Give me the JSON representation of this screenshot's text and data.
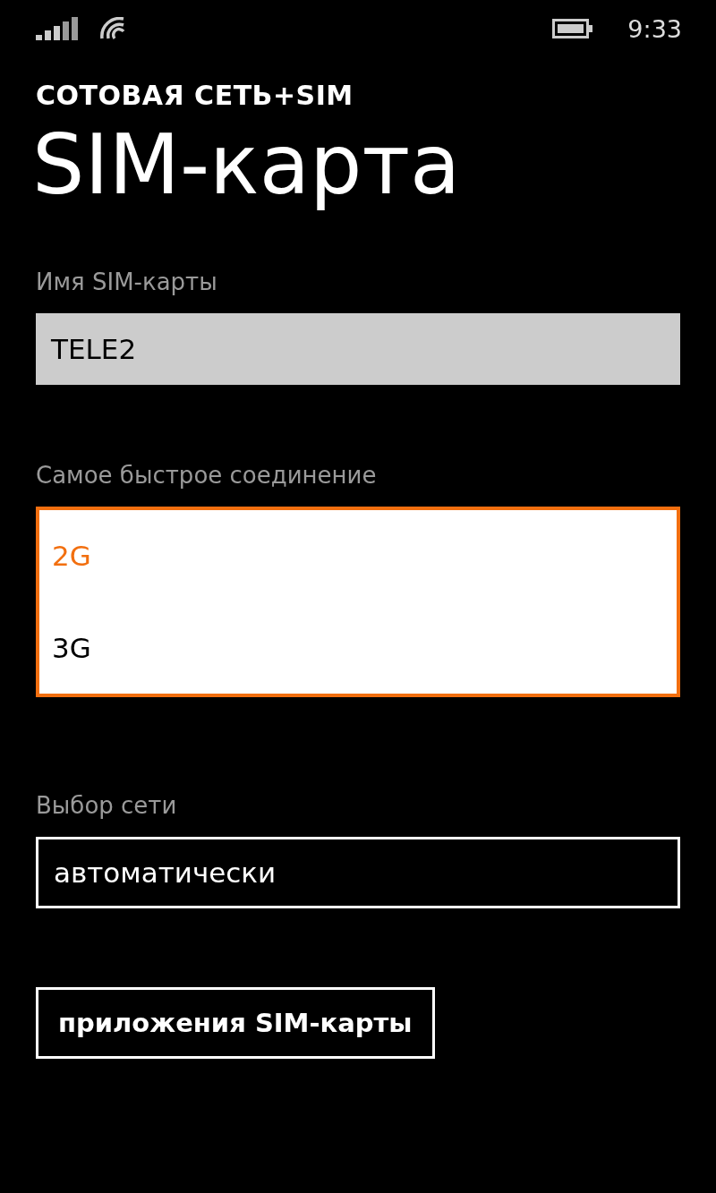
{
  "status_bar": {
    "time": "9:33"
  },
  "header": {
    "app_title": "СОТОВАЯ СЕТЬ+SIM",
    "page_title": "SIM-карта"
  },
  "sim_name": {
    "label": "Имя SIM-карты",
    "value": "TELE2"
  },
  "fastest_connection": {
    "label": "Самое быстрое соединение",
    "expanded": true,
    "options": [
      {
        "label": "2G",
        "selected": true
      },
      {
        "label": "3G",
        "selected": false
      }
    ]
  },
  "network_selection": {
    "label": "Выбор сети",
    "value": "автоматически"
  },
  "buttons": [
    "приложения SIM-карты"
  ]
}
